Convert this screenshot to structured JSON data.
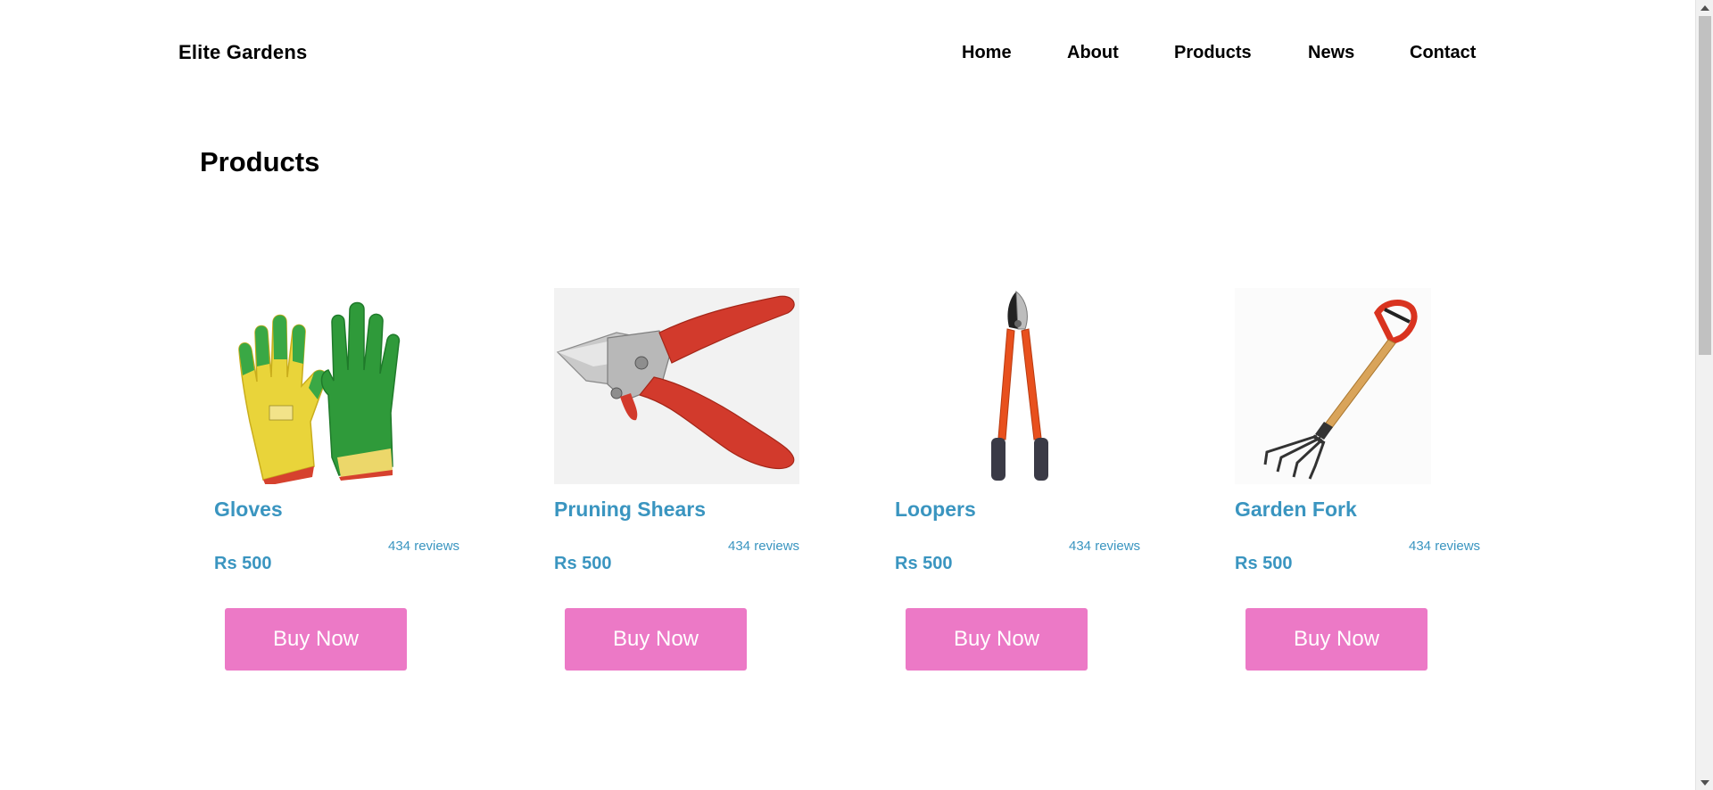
{
  "header": {
    "brand": "Elite Gardens",
    "nav": [
      "Home",
      "About",
      "Products",
      "News",
      "Contact"
    ]
  },
  "page_title": "Products",
  "products": [
    {
      "name": "Gloves",
      "reviews": "434 reviews",
      "price": "Rs 500",
      "cta": "Buy Now",
      "icon": "gardening-gloves-image"
    },
    {
      "name": "Pruning Shears",
      "reviews": "434 reviews",
      "price": "Rs 500",
      "cta": "Buy Now",
      "icon": "pruning-shears-image"
    },
    {
      "name": "Loopers",
      "reviews": "434 reviews",
      "price": "Rs 500",
      "cta": "Buy Now",
      "icon": "loppers-image"
    },
    {
      "name": "Garden Fork",
      "reviews": "434 reviews",
      "price": "Rs 500",
      "cta": "Buy Now",
      "icon": "garden-fork-image"
    }
  ],
  "colors": {
    "accent_text": "#3a95c0",
    "button_bg": "#ec79c6",
    "button_text": "#ffffff"
  }
}
